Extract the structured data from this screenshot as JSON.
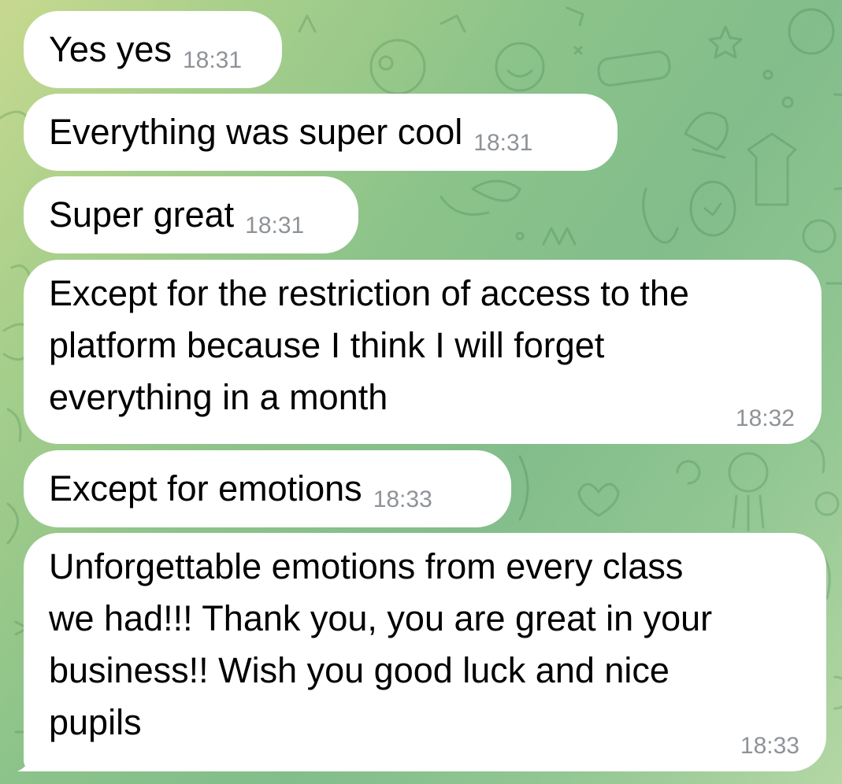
{
  "theme": {
    "bubble_color": "#ffffff",
    "text_color": "#000000",
    "time_color": "#8e9398",
    "wallpaper_accent": "#8cc38a"
  },
  "messages": [
    {
      "text": "Yes yes",
      "time": "18:31"
    },
    {
      "text": "Everything was super cool",
      "time": "18:31"
    },
    {
      "text": "Super great",
      "time": "18:31"
    },
    {
      "text": "Except for the restriction of access to the\nplatform because I think I will forget\neverything in a month",
      "time": "18:32"
    },
    {
      "text": "Except for emotions",
      "time": "18:33"
    },
    {
      "text": "Unforgettable emotions from every class\nwe had!!! Thank you, you are great in your\nbusiness!! Wish you good luck and nice\npupils",
      "time": "18:33"
    }
  ]
}
